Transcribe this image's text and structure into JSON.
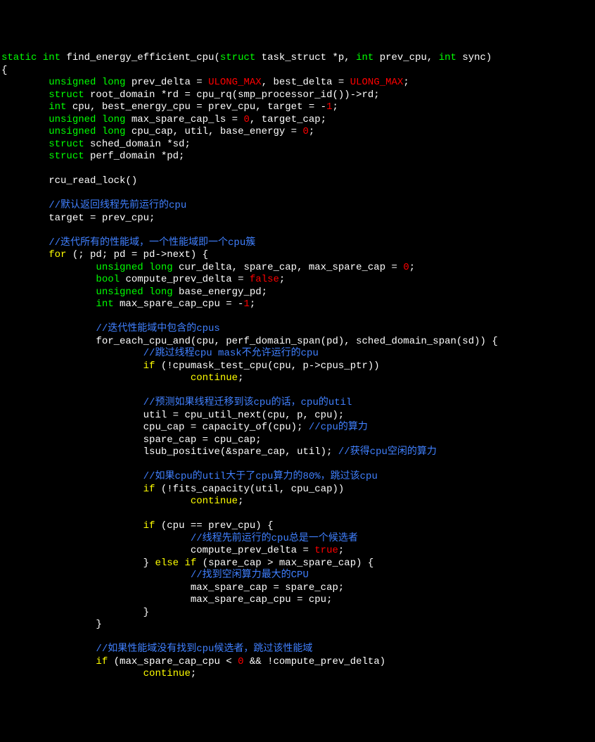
{
  "code": {
    "lines": [
      {
        "n": 1,
        "segs": [
          {
            "cls": "kw-type",
            "t": "static int "
          },
          {
            "cls": "ident",
            "t": "find_energy_efficient_cpu("
          },
          {
            "cls": "kw-type",
            "t": "struct "
          },
          {
            "cls": "ident",
            "t": "task_struct *p, "
          },
          {
            "cls": "kw-type",
            "t": "int "
          },
          {
            "cls": "ident",
            "t": "prev_cpu, "
          },
          {
            "cls": "kw-type",
            "t": "int "
          },
          {
            "cls": "ident",
            "t": "sync)"
          }
        ]
      },
      {
        "n": 2,
        "segs": [
          {
            "cls": "punct",
            "t": "{"
          }
        ]
      },
      {
        "n": 3,
        "segs": [
          {
            "cls": "",
            "t": "        "
          },
          {
            "cls": "kw-type",
            "t": "unsigned long "
          },
          {
            "cls": "ident",
            "t": "prev_delta = "
          },
          {
            "cls": "const",
            "t": "ULONG_MAX"
          },
          {
            "cls": "ident",
            "t": ", best_delta = "
          },
          {
            "cls": "const",
            "t": "ULONG_MAX"
          },
          {
            "cls": "punct",
            "t": ";"
          }
        ]
      },
      {
        "n": 4,
        "segs": [
          {
            "cls": "",
            "t": "        "
          },
          {
            "cls": "kw-type",
            "t": "struct "
          },
          {
            "cls": "ident",
            "t": "root_domain *rd = cpu_rq(smp_processor_id())->rd;"
          }
        ]
      },
      {
        "n": 5,
        "segs": [
          {
            "cls": "",
            "t": "        "
          },
          {
            "cls": "kw-type",
            "t": "int "
          },
          {
            "cls": "ident",
            "t": "cpu, best_energy_cpu = prev_cpu, target = -"
          },
          {
            "cls": "const",
            "t": "1"
          },
          {
            "cls": "punct",
            "t": ";"
          }
        ]
      },
      {
        "n": 6,
        "segs": [
          {
            "cls": "",
            "t": "        "
          },
          {
            "cls": "kw-type",
            "t": "unsigned long "
          },
          {
            "cls": "ident",
            "t": "max_spare_cap_ls = "
          },
          {
            "cls": "const",
            "t": "0"
          },
          {
            "cls": "ident",
            "t": ", target_cap;"
          }
        ]
      },
      {
        "n": 7,
        "segs": [
          {
            "cls": "",
            "t": "        "
          },
          {
            "cls": "kw-type",
            "t": "unsigned long "
          },
          {
            "cls": "ident",
            "t": "cpu_cap, util, base_energy = "
          },
          {
            "cls": "const",
            "t": "0"
          },
          {
            "cls": "punct",
            "t": ";"
          }
        ]
      },
      {
        "n": 8,
        "segs": [
          {
            "cls": "",
            "t": "        "
          },
          {
            "cls": "kw-type",
            "t": "struct "
          },
          {
            "cls": "ident",
            "t": "sched_domain *sd;"
          }
        ]
      },
      {
        "n": 9,
        "segs": [
          {
            "cls": "",
            "t": "        "
          },
          {
            "cls": "kw-type",
            "t": "struct "
          },
          {
            "cls": "ident",
            "t": "perf_domain *pd;"
          }
        ]
      },
      {
        "n": 10,
        "segs": [
          {
            "cls": "",
            "t": " "
          }
        ]
      },
      {
        "n": 11,
        "segs": [
          {
            "cls": "",
            "t": "        "
          },
          {
            "cls": "ident",
            "t": "rcu_read_lock()"
          }
        ]
      },
      {
        "n": 12,
        "segs": [
          {
            "cls": "",
            "t": " "
          }
        ]
      },
      {
        "n": 13,
        "segs": [
          {
            "cls": "",
            "t": "        "
          },
          {
            "cls": "cmt",
            "t": "//默认返回线程先前运行的cpu"
          }
        ]
      },
      {
        "n": 14,
        "segs": [
          {
            "cls": "",
            "t": "        "
          },
          {
            "cls": "ident",
            "t": "target = prev_cpu;"
          }
        ]
      },
      {
        "n": 15,
        "segs": [
          {
            "cls": "",
            "t": " "
          }
        ]
      },
      {
        "n": 16,
        "segs": [
          {
            "cls": "",
            "t": "        "
          },
          {
            "cls": "cmt",
            "t": "//迭代所有的性能域，一个性能域即一个cpu簇"
          }
        ]
      },
      {
        "n": 17,
        "segs": [
          {
            "cls": "",
            "t": "        "
          },
          {
            "cls": "kw-ctrl",
            "t": "for "
          },
          {
            "cls": "ident",
            "t": "(; pd; pd = pd->next) {"
          }
        ]
      },
      {
        "n": 18,
        "segs": [
          {
            "cls": "",
            "t": "                "
          },
          {
            "cls": "kw-type",
            "t": "unsigned long "
          },
          {
            "cls": "ident",
            "t": "cur_delta, spare_cap, max_spare_cap = "
          },
          {
            "cls": "const",
            "t": "0"
          },
          {
            "cls": "punct",
            "t": ";"
          }
        ]
      },
      {
        "n": 19,
        "segs": [
          {
            "cls": "",
            "t": "                "
          },
          {
            "cls": "kw-type",
            "t": "bool "
          },
          {
            "cls": "ident",
            "t": "compute_prev_delta = "
          },
          {
            "cls": "const",
            "t": "false"
          },
          {
            "cls": "punct",
            "t": ";"
          }
        ]
      },
      {
        "n": 20,
        "segs": [
          {
            "cls": "",
            "t": "                "
          },
          {
            "cls": "kw-type",
            "t": "unsigned long "
          },
          {
            "cls": "ident",
            "t": "base_energy_pd;"
          }
        ]
      },
      {
        "n": 21,
        "segs": [
          {
            "cls": "",
            "t": "                "
          },
          {
            "cls": "kw-type",
            "t": "int "
          },
          {
            "cls": "ident",
            "t": "max_spare_cap_cpu = -"
          },
          {
            "cls": "const",
            "t": "1"
          },
          {
            "cls": "punct",
            "t": ";"
          }
        ]
      },
      {
        "n": 22,
        "segs": [
          {
            "cls": "",
            "t": " "
          }
        ]
      },
      {
        "n": 23,
        "segs": [
          {
            "cls": "",
            "t": "                "
          },
          {
            "cls": "cmt",
            "t": "//迭代性能域中包含的cpus"
          }
        ]
      },
      {
        "n": 24,
        "segs": [
          {
            "cls": "",
            "t": "                "
          },
          {
            "cls": "ident",
            "t": "for_each_cpu_and(cpu, perf_domain_span(pd), sched_domain_span(sd)) {"
          }
        ]
      },
      {
        "n": 25,
        "segs": [
          {
            "cls": "",
            "t": "                        "
          },
          {
            "cls": "cmt",
            "t": "//跳过线程cpu mask不允许运行的cpu"
          }
        ]
      },
      {
        "n": 26,
        "segs": [
          {
            "cls": "",
            "t": "                        "
          },
          {
            "cls": "kw-ctrl",
            "t": "if "
          },
          {
            "cls": "ident",
            "t": "(!cpumask_test_cpu(cpu, p->cpus_ptr))"
          }
        ]
      },
      {
        "n": 27,
        "segs": [
          {
            "cls": "",
            "t": "                                "
          },
          {
            "cls": "kw-ctrl",
            "t": "continue"
          },
          {
            "cls": "punct",
            "t": ";"
          }
        ]
      },
      {
        "n": 28,
        "segs": [
          {
            "cls": "",
            "t": " "
          }
        ]
      },
      {
        "n": 29,
        "segs": [
          {
            "cls": "",
            "t": "                        "
          },
          {
            "cls": "cmt",
            "t": "//预测如果线程迁移到该cpu的话，cpu的util"
          }
        ]
      },
      {
        "n": 30,
        "segs": [
          {
            "cls": "",
            "t": "                        "
          },
          {
            "cls": "ident",
            "t": "util = cpu_util_next(cpu, p, cpu);"
          }
        ]
      },
      {
        "n": 31,
        "segs": [
          {
            "cls": "",
            "t": "                        "
          },
          {
            "cls": "ident",
            "t": "cpu_cap = capacity_of(cpu); "
          },
          {
            "cls": "cmt",
            "t": "//cpu的算力"
          }
        ]
      },
      {
        "n": 32,
        "segs": [
          {
            "cls": "",
            "t": "                        "
          },
          {
            "cls": "ident",
            "t": "spare_cap = cpu_cap;"
          }
        ]
      },
      {
        "n": 33,
        "segs": [
          {
            "cls": "",
            "t": "                        "
          },
          {
            "cls": "ident",
            "t": "lsub_positive(&spare_cap, util); "
          },
          {
            "cls": "cmt",
            "t": "//获得cpu空闲的算力"
          }
        ]
      },
      {
        "n": 34,
        "segs": [
          {
            "cls": "",
            "t": " "
          }
        ]
      },
      {
        "n": 35,
        "segs": [
          {
            "cls": "",
            "t": "                        "
          },
          {
            "cls": "cmt",
            "t": "//如果cpu的util大于了cpu算力的80%，跳过该cpu"
          }
        ]
      },
      {
        "n": 36,
        "segs": [
          {
            "cls": "",
            "t": "                        "
          },
          {
            "cls": "kw-ctrl",
            "t": "if "
          },
          {
            "cls": "ident",
            "t": "(!fits_capacity(util, cpu_cap))"
          }
        ]
      },
      {
        "n": 37,
        "segs": [
          {
            "cls": "",
            "t": "                                "
          },
          {
            "cls": "kw-ctrl",
            "t": "continue"
          },
          {
            "cls": "punct",
            "t": ";"
          }
        ]
      },
      {
        "n": 38,
        "segs": [
          {
            "cls": "",
            "t": " "
          }
        ]
      },
      {
        "n": 39,
        "segs": [
          {
            "cls": "",
            "t": "                        "
          },
          {
            "cls": "kw-ctrl",
            "t": "if "
          },
          {
            "cls": "ident",
            "t": "(cpu == prev_cpu) {"
          }
        ]
      },
      {
        "n": 40,
        "segs": [
          {
            "cls": "",
            "t": "                                "
          },
          {
            "cls": "cmt",
            "t": "//线程先前运行的cpu总是一个候选者"
          }
        ]
      },
      {
        "n": 41,
        "segs": [
          {
            "cls": "",
            "t": "                                "
          },
          {
            "cls": "ident",
            "t": "compute_prev_delta = "
          },
          {
            "cls": "const",
            "t": "true"
          },
          {
            "cls": "punct",
            "t": ";"
          }
        ]
      },
      {
        "n": 42,
        "segs": [
          {
            "cls": "",
            "t": "                        "
          },
          {
            "cls": "ident",
            "t": "} "
          },
          {
            "cls": "kw-ctrl",
            "t": "else if "
          },
          {
            "cls": "ident",
            "t": "(spare_cap > max_spare_cap) {"
          }
        ]
      },
      {
        "n": 43,
        "segs": [
          {
            "cls": "",
            "t": "                                "
          },
          {
            "cls": "cmt",
            "t": "//找到空闲算力最大的CPU"
          }
        ]
      },
      {
        "n": 44,
        "segs": [
          {
            "cls": "",
            "t": "                                "
          },
          {
            "cls": "ident",
            "t": "max_spare_cap = spare_cap;"
          }
        ]
      },
      {
        "n": 45,
        "segs": [
          {
            "cls": "",
            "t": "                                "
          },
          {
            "cls": "ident",
            "t": "max_spare_cap_cpu = cpu;"
          }
        ]
      },
      {
        "n": 46,
        "segs": [
          {
            "cls": "",
            "t": "                        "
          },
          {
            "cls": "punct",
            "t": "}"
          }
        ]
      },
      {
        "n": 47,
        "segs": [
          {
            "cls": "",
            "t": "                "
          },
          {
            "cls": "punct",
            "t": "}"
          }
        ]
      },
      {
        "n": 48,
        "segs": [
          {
            "cls": "",
            "t": " "
          }
        ]
      },
      {
        "n": 49,
        "segs": [
          {
            "cls": "",
            "t": "                "
          },
          {
            "cls": "cmt",
            "t": "//如果性能域没有找到cpu候选者，跳过该性能域"
          }
        ]
      },
      {
        "n": 50,
        "segs": [
          {
            "cls": "",
            "t": "                "
          },
          {
            "cls": "kw-ctrl",
            "t": "if "
          },
          {
            "cls": "ident",
            "t": "(max_spare_cap_cpu < "
          },
          {
            "cls": "const",
            "t": "0"
          },
          {
            "cls": "ident",
            "t": " && !compute_prev_delta)"
          }
        ]
      },
      {
        "n": 51,
        "segs": [
          {
            "cls": "",
            "t": "                        "
          },
          {
            "cls": "kw-ctrl",
            "t": "continue"
          },
          {
            "cls": "punct",
            "t": ";"
          }
        ]
      }
    ]
  }
}
